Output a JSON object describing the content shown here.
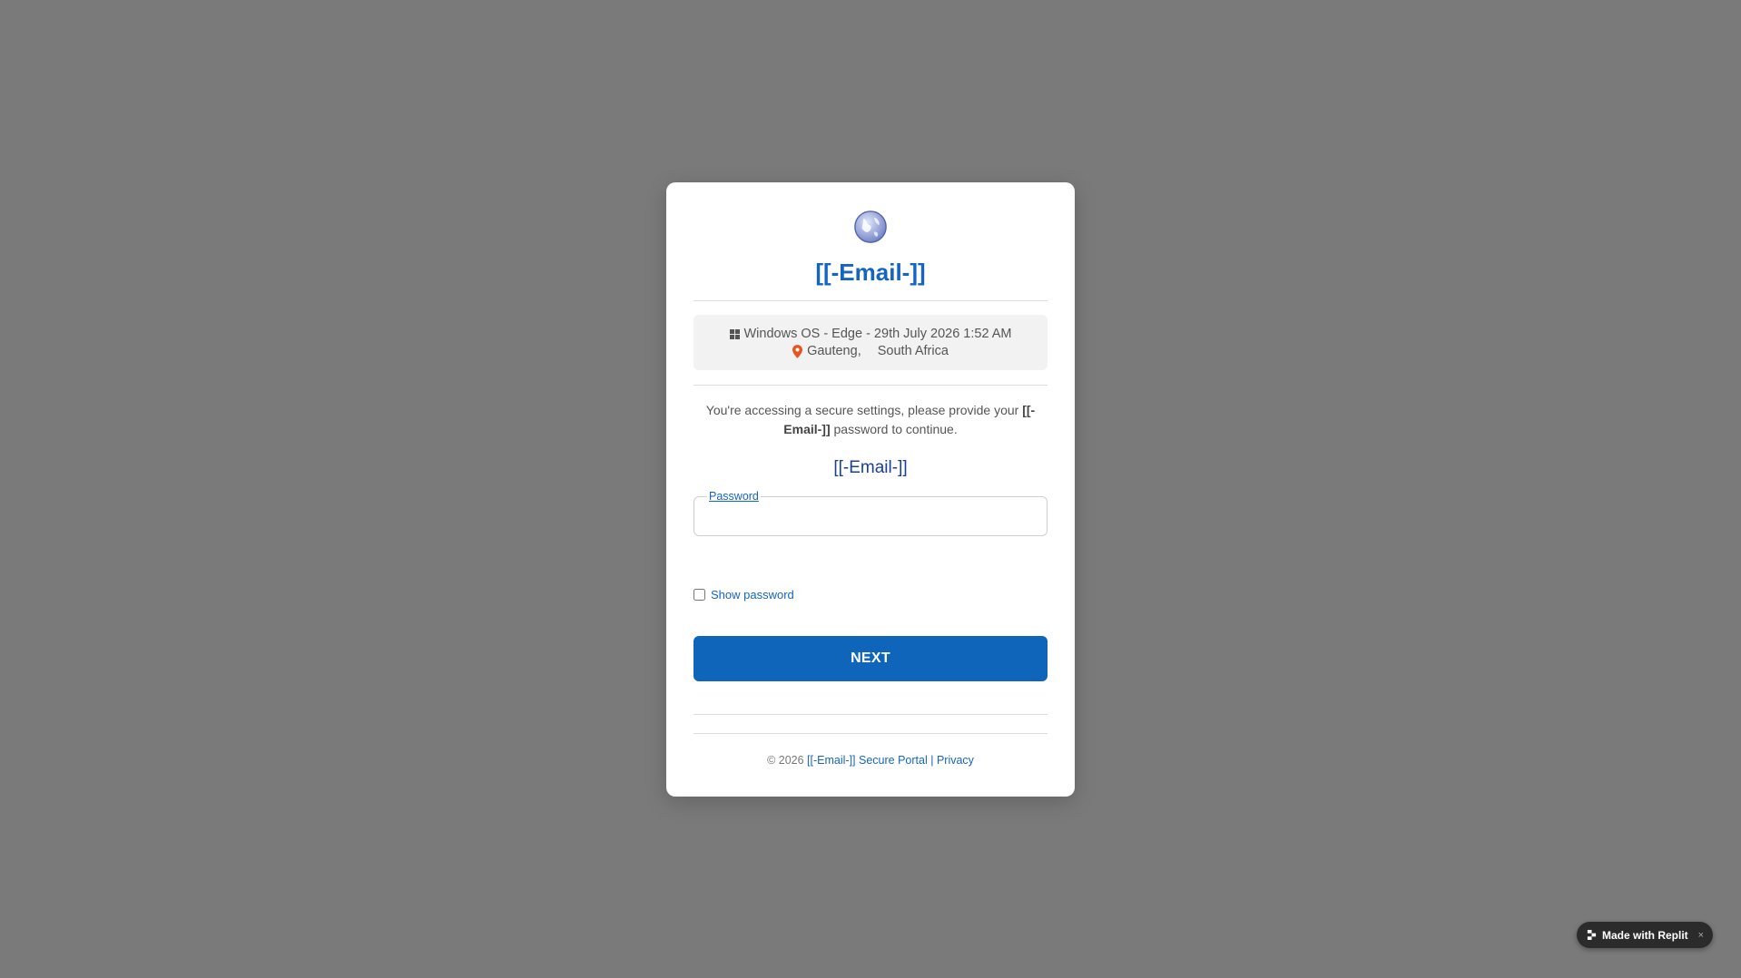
{
  "card": {
    "title": "[[-Email-]]",
    "device_info": {
      "os_line": "Windows OS - Edge - 29th July 2026 1:52 AM",
      "region": "Gauteng,",
      "country": "South Africa"
    },
    "notice": {
      "prefix": "You're accessing a secure settings, please provide your ",
      "email": "[[-Email-]]",
      "suffix": " password to continue."
    },
    "account_email": "[[-Email-]]",
    "password": {
      "label": "Password",
      "value": "",
      "placeholder": ""
    },
    "show_password_label": "Show password",
    "next_label": "NEXT",
    "footer": {
      "copyright": "© 2026 ",
      "portal_link": "[[-Email-]] Secure Portal",
      "separator": " | ",
      "privacy_link": "Privacy"
    }
  },
  "replit_badge": {
    "label": "Made with Replit",
    "close": "×"
  },
  "colors": {
    "background": "#7a7a7a",
    "accent": "#1565c0",
    "button": "#0e65b9",
    "location_pin": "#e8541c"
  },
  "icons": [
    "globe-icon",
    "windows-icon",
    "location-pin-icon",
    "replit-icon",
    "close-icon"
  ]
}
